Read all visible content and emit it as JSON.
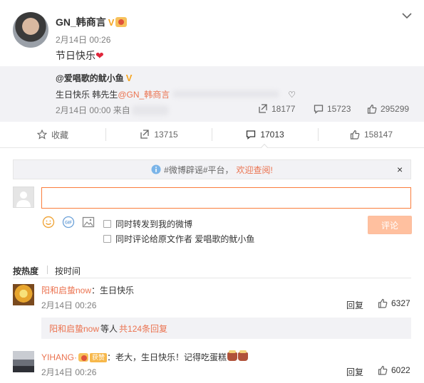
{
  "post": {
    "username": "GN_韩商言",
    "verified_badge": "V",
    "time": "2月14日 00:26",
    "text": "节日快乐",
    "emoji": "❤"
  },
  "repost": {
    "username": "@爱唱歌的鱿小鱼",
    "verified_badge": "V",
    "text_prefix": "生日快乐 韩先生",
    "mention": "@GN_韩商言",
    "text_suffix": "♡",
    "time": "2月14日 00:00 来自",
    "reposts": "18177",
    "comments": "15723",
    "likes": "295299"
  },
  "actions": {
    "favorite_label": "收藏",
    "repost_count": "13715",
    "comment_count": "17013",
    "like_count": "158147"
  },
  "notice": {
    "text": "#微博辟谣#平台，",
    "link": "欢迎查阅!",
    "close": "×"
  },
  "composer": {
    "input_value": "",
    "placeholder": "",
    "option_repost": "同时转发到我的微博",
    "option_comment_to_author": "同时评论给原文作者 爱唱歌的鱿小鱼",
    "submit_label": "评论"
  },
  "sort": {
    "hot": "按热度",
    "time": "按时间"
  },
  "comments": [
    {
      "name": "阳和启蛰now",
      "text": "：生日快乐",
      "time": "2月14日 00:26",
      "reply_label": "回复",
      "likes": "6327"
    },
    {
      "name": "YIHANG·",
      "medal": "获赞",
      "text": "：老大，生日快乐！记得吃蛋糕",
      "time": "2月14日 00:26",
      "reply_label": "回复",
      "likes": "6022"
    }
  ],
  "reply_summary": {
    "name": "阳和启蛰now",
    "middle": " 等人 ",
    "link": "共124条回复"
  },
  "colors": {
    "accent": "#eb7350",
    "input_border": "#fa7d3c",
    "submit_bg": "#ffc09f",
    "verified": "#f5a623",
    "panel_bg": "#f2f2f5"
  }
}
